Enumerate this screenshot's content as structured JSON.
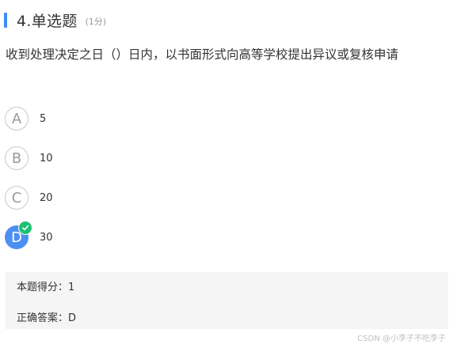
{
  "question": {
    "title": "4.单选题",
    "score": "(1分)",
    "stem": "收到处理决定之日（）日内，以书面形式向高等学校提出异议或复核申请"
  },
  "options": [
    {
      "letter": "A",
      "text": "5"
    },
    {
      "letter": "B",
      "text": "10"
    },
    {
      "letter": "C",
      "text": "20"
    },
    {
      "letter": "D",
      "text": "30",
      "selected": true
    }
  ],
  "result": {
    "score_label": "本题得分：",
    "score_value": "1",
    "answer_label": "正确答案：",
    "answer_value": "D"
  },
  "watermark": "CSDN @小李子不吃李子",
  "colors": {
    "accent": "#3d8ef0",
    "selected": "#4c8ff0",
    "correct": "#1dbf73",
    "result_bg": "#f5f5f5"
  },
  "icons": {
    "check": "check-icon"
  }
}
